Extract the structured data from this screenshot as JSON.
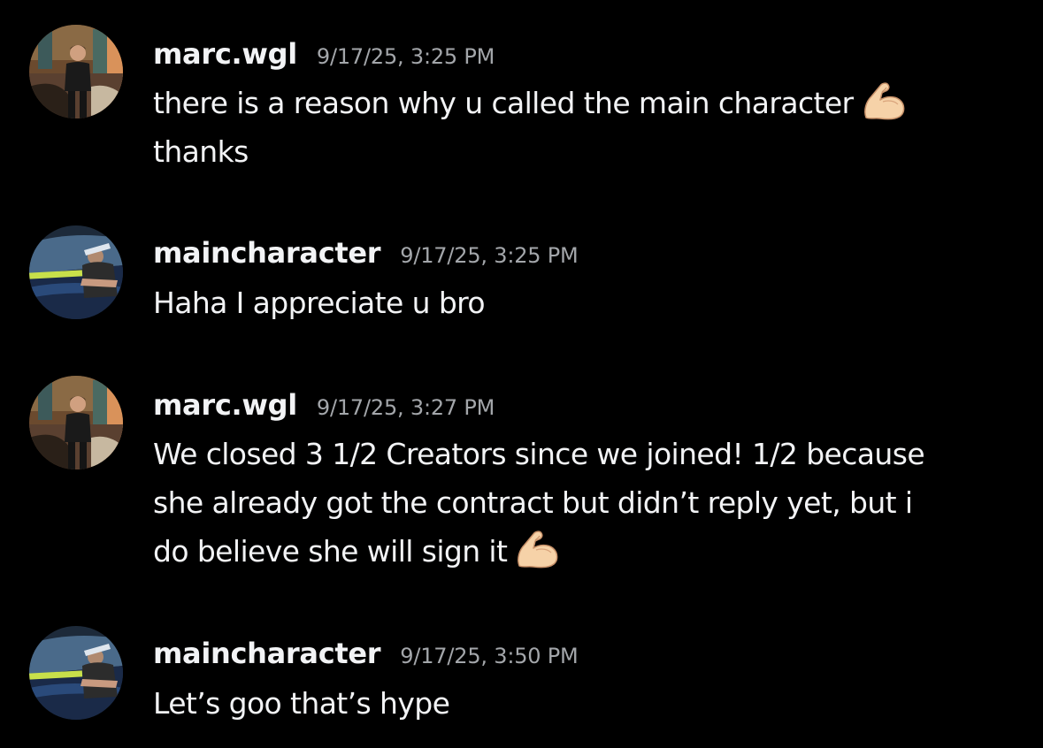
{
  "colors": {
    "background": "#000000",
    "text": "#f2f3f5",
    "timestamp": "#a3a6aa"
  },
  "messages": [
    {
      "username": "marc.wgl",
      "timestamp": "9/17/25, 3:25 PM",
      "avatar_icon": "marc-avatar",
      "lines": [
        "there is a reason why u called the main character",
        "thanks"
      ],
      "emoji": "flexed-biceps"
    },
    {
      "username": "maincharacter",
      "timestamp": "9/17/25, 3:25 PM",
      "avatar_icon": "maincharacter-avatar",
      "lines": [
        "Haha I appreciate u bro"
      ]
    },
    {
      "username": "marc.wgl",
      "timestamp": "9/17/25, 3:27 PM",
      "avatar_icon": "marc-avatar",
      "lines": [
        "We closed 3 1/2 Creators since we joined! 1/2 because",
        "she already got the contract but didn’t reply yet, but i",
        "do believe she will sign it"
      ],
      "emoji": "flexed-biceps"
    },
    {
      "username": "maincharacter",
      "timestamp": "9/17/25, 3:50 PM",
      "avatar_icon": "maincharacter-avatar",
      "lines": [
        "Let’s goo that’s hype"
      ]
    }
  ]
}
